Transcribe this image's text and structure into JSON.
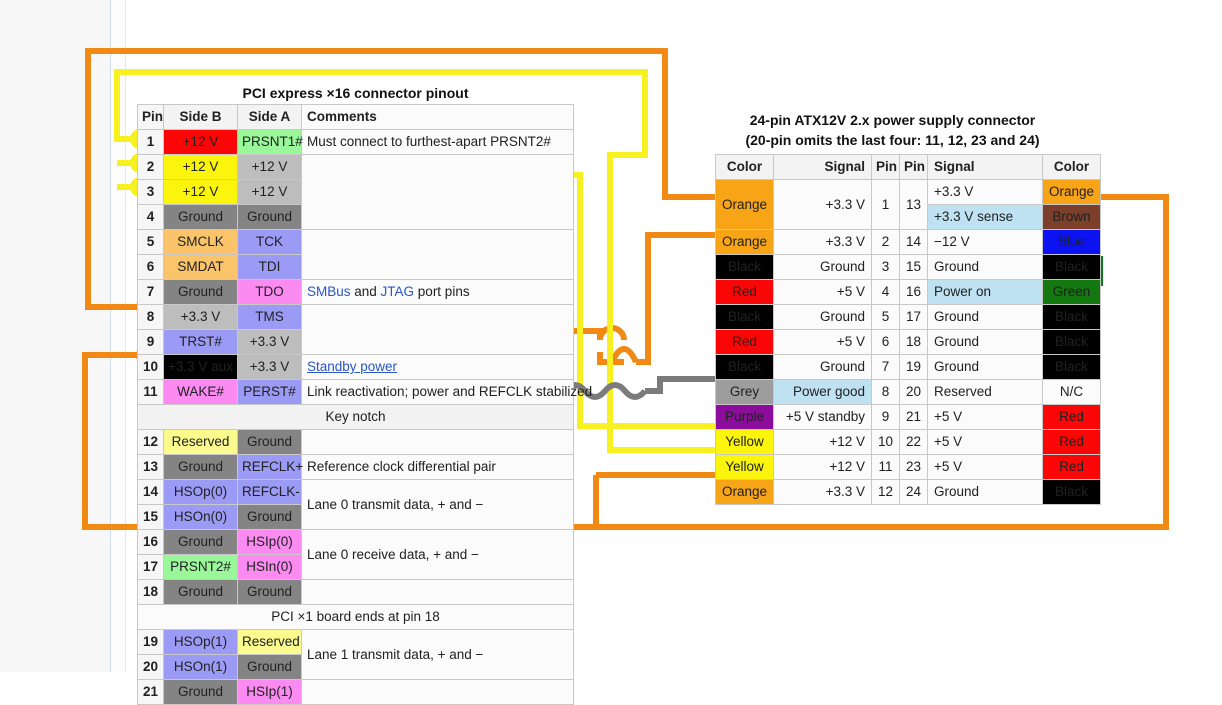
{
  "pci": {
    "title": "PCI express ×16 connector pinout",
    "headers": [
      "Pin",
      "Side B",
      "Side A",
      "Comments"
    ],
    "rows": [
      {
        "pin": "1",
        "b": "+12 V",
        "b_cls": "p-red",
        "a": "PRSNT1#",
        "a_cls": "p-lgreen",
        "comment": "Must connect to furthest-apart PRSNT2#",
        "c_rowspan": 1
      },
      {
        "pin": "2",
        "b": "+12 V",
        "b_cls": "p-yellow",
        "a": "+12 V",
        "a_cls": "p-lgrey",
        "comment": "",
        "c_rowspan": 3
      },
      {
        "pin": "3",
        "b": "+12 V",
        "b_cls": "p-yellow",
        "a": "+12 V",
        "a_cls": "p-lgrey"
      },
      {
        "pin": "4",
        "b": "Ground",
        "b_cls": "p-grey",
        "a": "Ground",
        "a_cls": "p-grey"
      },
      {
        "pin": "5",
        "b": "SMCLK",
        "b_cls": "p-orange",
        "a": "TCK",
        "a_cls": "p-periw",
        "comment": "",
        "c_rowspan": 2
      },
      {
        "pin": "6",
        "b": "SMDAT",
        "b_cls": "p-orange",
        "a": "TDI",
        "a_cls": "p-periw"
      },
      {
        "pin": "7",
        "b": "Ground",
        "b_cls": "p-grey",
        "a": "TDO",
        "a_cls": "p-pink",
        "comment": "SMBus and JTAG port pins",
        "comment_kind": "smbus",
        "c_rowspan": 1
      },
      {
        "pin": "8",
        "b": "+3.3 V",
        "b_cls": "p-lgrey",
        "a": "TMS",
        "a_cls": "p-periw",
        "comment": "",
        "c_rowspan": 2
      },
      {
        "pin": "9",
        "b": "TRST#",
        "b_cls": "p-periw",
        "a": "+3.3 V",
        "a_cls": "p-lgrey"
      },
      {
        "pin": "10",
        "b": "+3.3 V aux",
        "b_cls": "p-black",
        "a": "+3.3 V",
        "a_cls": "p-lgrey",
        "comment": "Standby power",
        "comment_kind": "link",
        "c_rowspan": 1
      },
      {
        "pin": "11",
        "b": "WAKE#",
        "b_cls": "p-pink",
        "a": "PERST#",
        "a_cls": "p-periw",
        "comment": "Link reactivation; power and REFCLK stabilized",
        "c_rowspan": 1
      }
    ],
    "key_notch": "Key notch",
    "rows2": [
      {
        "pin": "12",
        "b": "Reserved",
        "b_cls": "p-lyellow",
        "a": "Ground",
        "a_cls": "p-grey",
        "comment": "",
        "c_rowspan": 1
      },
      {
        "pin": "13",
        "b": "Ground",
        "b_cls": "p-grey",
        "a": "REFCLK+",
        "a_cls": "p-periw",
        "comment": "Reference clock differential pair",
        "c_rowspan": 1
      },
      {
        "pin": "14",
        "b": "HSOp(0)",
        "b_cls": "p-periw",
        "a": "REFCLK-",
        "a_cls": "p-periw",
        "comment": "Lane 0 transmit data, + and −",
        "c_rowspan": 2
      },
      {
        "pin": "15",
        "b": "HSOn(0)",
        "b_cls": "p-periw",
        "a": "Ground",
        "a_cls": "p-grey"
      },
      {
        "pin": "16",
        "b": "Ground",
        "b_cls": "p-grey",
        "a": "HSIp(0)",
        "a_cls": "p-pink",
        "comment": "Lane 0 receive data, + and −",
        "c_rowspan": 2
      },
      {
        "pin": "17",
        "b": "PRSNT2#",
        "b_cls": "p-lgreen",
        "a": "HSIn(0)",
        "a_cls": "p-pink"
      },
      {
        "pin": "18",
        "b": "Ground",
        "b_cls": "p-grey",
        "a": "Ground",
        "a_cls": "p-grey",
        "comment": "",
        "c_rowspan": 1
      }
    ],
    "end_note": "PCI ×1 board ends at pin 18",
    "rows3": [
      {
        "pin": "19",
        "b": "HSOp(1)",
        "b_cls": "p-periw",
        "a": "Reserved",
        "a_cls": "p-lyellow",
        "comment": "Lane 1 transmit data, + and −",
        "c_rowspan": 2
      },
      {
        "pin": "20",
        "b": "HSOn(1)",
        "b_cls": "p-periw",
        "a": "Ground",
        "a_cls": "p-grey"
      },
      {
        "pin": "21",
        "b": "Ground",
        "b_cls": "p-grey",
        "a": "HSIp(1)",
        "a_cls": "p-pink",
        "comment": "",
        "c_rowspan": 1
      }
    ],
    "comment_smbus_parts": [
      "SMBus",
      " and ",
      "JTAG",
      " port pins"
    ]
  },
  "atx": {
    "title_line1": "24-pin ATX12V 2.x power supply connector",
    "title_line2": "(20-pin omits the last four: 11, 12, 23 and 24)",
    "headers": [
      "Color",
      "Signal",
      "Pin",
      "Pin",
      "Signal",
      "Color"
    ],
    "rows": [
      {
        "colorL": "Orange",
        "clsL": "c-orange",
        "sigL": "+3.3 V",
        "pinL": "1",
        "pinR": "13",
        "sigR": "+3.3 V",
        "clsSigR": "c-nc",
        "colorR": "Orange",
        "clsR": "c-orange",
        "split": true,
        "sigR2": "+3.3 V sense",
        "clsSigR2": "c-ltblue",
        "colorR2": "Brown",
        "clsR2": "c-brown"
      },
      {
        "colorL": "Orange",
        "clsL": "c-orange",
        "sigL": "+3.3 V",
        "pinL": "2",
        "pinR": "14",
        "sigR": "−12 V",
        "clsSigR": "c-nc",
        "colorR": "Blue",
        "clsR": "c-blue"
      },
      {
        "colorL": "Black",
        "clsL": "c-black",
        "sigL": "Ground",
        "pinL": "3",
        "pinR": "15",
        "sigR": "Ground",
        "clsSigR": "c-nc",
        "colorR": "Black",
        "clsR": "c-black"
      },
      {
        "colorL": "Red",
        "clsL": "c-red",
        "sigL": "+5 V",
        "pinL": "4",
        "pinR": "16",
        "sigR": "Power on",
        "clsSigR": "c-ltblue",
        "colorR": "Green",
        "clsR": "c-green"
      },
      {
        "colorL": "Black",
        "clsL": "c-black",
        "sigL": "Ground",
        "pinL": "5",
        "pinR": "17",
        "sigR": "Ground",
        "clsSigR": "c-nc",
        "colorR": "Black",
        "clsR": "c-black"
      },
      {
        "colorL": "Red",
        "clsL": "c-red",
        "sigL": "+5 V",
        "pinL": "6",
        "pinR": "18",
        "sigR": "Ground",
        "clsSigR": "c-nc",
        "colorR": "Black",
        "clsR": "c-black"
      },
      {
        "colorL": "Black",
        "clsL": "c-black",
        "sigL": "Ground",
        "pinL": "7",
        "pinR": "19",
        "sigR": "Ground",
        "clsSigR": "c-nc",
        "colorR": "Black",
        "clsR": "c-black"
      },
      {
        "colorL": "Grey",
        "clsL": "c-grey",
        "sigL": "Power good",
        "clsSigL": "c-ltblue",
        "pinL": "8",
        "pinR": "20",
        "sigR": "Reserved",
        "clsSigR": "c-nc",
        "colorR": "N/C",
        "clsR": "c-nc"
      },
      {
        "colorL": "Purple",
        "clsL": "c-purple",
        "sigL": "+5 V standby",
        "pinL": "9",
        "pinR": "21",
        "sigR": "+5 V",
        "clsSigR": "c-nc",
        "colorR": "Red",
        "clsR": "c-red"
      },
      {
        "colorL": "Yellow",
        "clsL": "c-yellow",
        "sigL": "+12 V",
        "pinL": "10",
        "pinR": "22",
        "sigR": "+5 V",
        "clsSigR": "c-nc",
        "colorR": "Red",
        "clsR": "c-red"
      },
      {
        "colorL": "Yellow",
        "clsL": "c-yellow",
        "sigL": "+12 V",
        "pinL": "11",
        "pinR": "23",
        "sigR": "+5 V",
        "clsSigR": "c-nc",
        "colorR": "Red",
        "clsR": "c-red"
      },
      {
        "colorL": "Orange",
        "clsL": "c-orange",
        "sigL": "+3.3 V",
        "pinL": "12",
        "pinR": "24",
        "sigR": "Ground",
        "clsSigR": "c-nc",
        "colorR": "Black",
        "clsR": "c-black"
      }
    ]
  },
  "wires": {
    "yellow": "#f7f121",
    "orange": "#f18a14",
    "grey": "#7b7b7b",
    "green": "#0c7a16"
  }
}
